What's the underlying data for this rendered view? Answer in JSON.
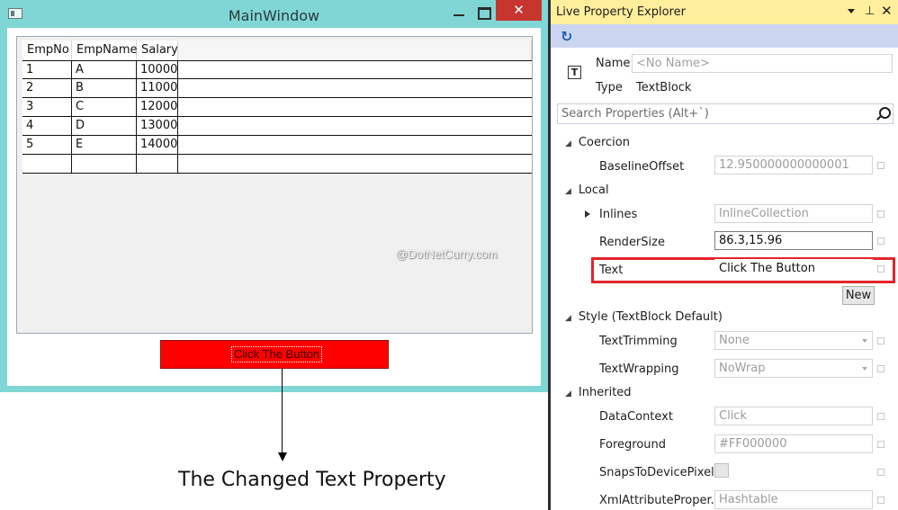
{
  "main_window": {
    "title": "MainWindow",
    "close_glyph": "✕",
    "grid": {
      "columns": [
        "EmpNo",
        "EmpName",
        "Salary"
      ],
      "rows": [
        [
          "1",
          "A",
          "10000"
        ],
        [
          "2",
          "B",
          "11000"
        ],
        [
          "3",
          "C",
          "12000"
        ],
        [
          "4",
          "D",
          "13000"
        ],
        [
          "5",
          "E",
          "14000"
        ],
        [
          "",
          "",
          ""
        ]
      ]
    },
    "watermark": "@DotNetCurry.com",
    "button_label": "Click The Button",
    "button_color": "#ff0000"
  },
  "caption": "The Changed Text Property",
  "lpe": {
    "title": "Live Property Explorer",
    "pin_glyph": "⊥",
    "close_glyph": "✕",
    "refresh_glyph": "↻",
    "type_icon_glyph": "T",
    "name_label": "Name",
    "name_value": "<No Name>",
    "type_label": "Type",
    "type_value": "TextBlock",
    "search_placeholder": "Search Properties (Alt+`)",
    "categories": {
      "coercion": "Coercion",
      "local": "Local",
      "style": "Style (TextBlock Default)",
      "inherited": "Inherited"
    },
    "props": {
      "baseline_offset": {
        "label": "BaselineOffset",
        "value": "12.950000000000001"
      },
      "inlines": {
        "label": "Inlines",
        "value": "InlineCollection"
      },
      "render_size": {
        "label": "RenderSize",
        "value": "86.3,15.96"
      },
      "text": {
        "label": "Text",
        "value": "Click The Button"
      },
      "text_trimming": {
        "label": "TextTrimming",
        "value": "None"
      },
      "text_wrapping": {
        "label": "TextWrapping",
        "value": "NoWrap"
      },
      "data_context": {
        "label": "DataContext",
        "value": "Click"
      },
      "foreground": {
        "label": "Foreground",
        "value": "#FF000000"
      },
      "snaps_to_device_pixels": {
        "label": "SnapsToDevicePixels"
      },
      "xml_attribute": {
        "label": "XmlAttributeProper...",
        "value": "Hashtable"
      }
    },
    "new_button": "New",
    "highlight_color": "#e3242b"
  }
}
